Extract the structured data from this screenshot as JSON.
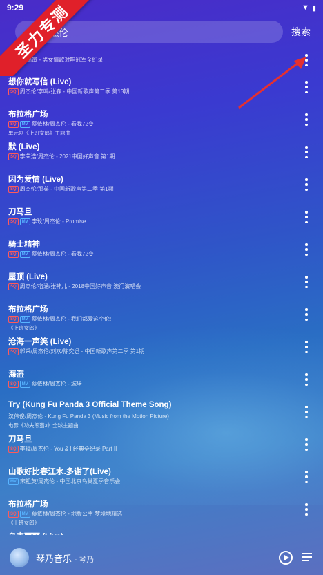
{
  "status": {
    "time": "9:29",
    "signal": "▼",
    "battery": "▮"
  },
  "search": {
    "query": "周杰伦",
    "prefix": "\\",
    "button": "搜索"
  },
  "banner": {
    "text": "圣力专测"
  },
  "songs": [
    {
      "title": "",
      "subtitle": "周杰伦/温岚 - 男女情歌对唱冠军全纪录",
      "badges": [],
      "note": ""
    },
    {
      "title": "想你就写信 (Live)",
      "subtitle": "周杰伦/李鸣/张森 - 中国新歌声第二季 第13期",
      "badges": [
        "SQ"
      ],
      "note": ""
    },
    {
      "title": "布拉格广场",
      "subtitle": "蔡依林/周杰伦 - 看我72变",
      "badges": [
        "SQ",
        "MV"
      ],
      "note": "单元剧《上班女郎》主题曲"
    },
    {
      "title": "默 (Live)",
      "subtitle": "李荣浩/周杰伦 - 2021中国好声音 第1期",
      "badges": [
        "SQ"
      ],
      "note": ""
    },
    {
      "title": "因为爱情 (Live)",
      "subtitle": "周杰伦/那英 - 中国新歌声第二季 第1期",
      "badges": [
        "SQ"
      ],
      "note": ""
    },
    {
      "title": "刀马旦",
      "subtitle": "李玟/周杰伦 - Promise",
      "badges": [
        "SQ",
        "MV"
      ],
      "note": ""
    },
    {
      "title": "骑士精神",
      "subtitle": "蔡依林/周杰伦 - 看我72变",
      "badges": [
        "SQ",
        "MV"
      ],
      "note": ""
    },
    {
      "title": "屋顶 (Live)",
      "subtitle": "周杰伦/宿涵/张神儿 - 2018中国好声音 澳门演唱会",
      "badges": [
        "SQ"
      ],
      "note": ""
    },
    {
      "title": "布拉格广场",
      "subtitle": "蔡依林/周杰伦 - 我们都爱这个伦!",
      "badges": [
        "SQ",
        "MV"
      ],
      "note": "《上班女郎》"
    },
    {
      "title": "沧海一声笑 (Live)",
      "subtitle": "郭采/周杰伦/刘欢/陈奕迅 - 中国新歌声第二季 第1期",
      "badges": [
        "SQ"
      ],
      "note": ""
    },
    {
      "title": "海盗",
      "subtitle": "蔡依林/周杰伦 - 城堡",
      "badges": [
        "SQ",
        "MV"
      ],
      "note": ""
    },
    {
      "title": "Try (Kung Fu Panda 3 Official Theme Song)",
      "subtitle": "汉伟俊/周杰伦 - Kung Fu Panda 3 (Music from the Motion Picture)",
      "badges": [],
      "note": "电影《功夫熊猫3》全球主题曲"
    },
    {
      "title": "刀马旦",
      "subtitle": "李玟/周杰伦 - You & I 经典全纪录 Part II",
      "badges": [
        "SQ"
      ],
      "note": ""
    },
    {
      "title": "山歌好比春江水.多谢了(Live)",
      "subtitle": "宋祖英/周杰伦 - 中国北京鸟巢夏季音乐会",
      "badges": [
        "MV"
      ],
      "note": ""
    },
    {
      "title": "布拉格广场",
      "subtitle": "蔡依林/周杰伦 - 地版公主 梦境地精选",
      "badges": [
        "SQ",
        "MV"
      ],
      "note": "《上班女郎》"
    },
    {
      "title": "乌克丽丽 (Live)",
      "subtitle": "",
      "badges": [],
      "note": ""
    }
  ],
  "player": {
    "title": "琴乃音乐",
    "artist": "琴乃"
  },
  "colors": {
    "accent": "#e0202a",
    "sq_badge": "#ff5a5a",
    "mv_badge": "#58b4ff"
  }
}
